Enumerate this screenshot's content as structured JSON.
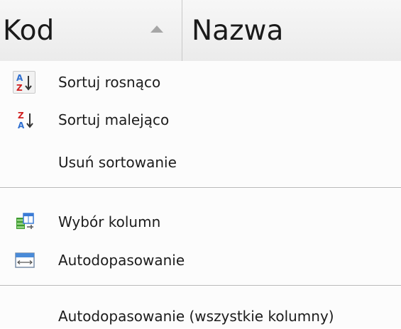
{
  "header": {
    "columns": [
      {
        "label": "Kod",
        "sorted": "ascending"
      },
      {
        "label": "Nazwa"
      }
    ]
  },
  "menu": {
    "items": [
      {
        "label": "Sortuj rosnąco",
        "icon": "sort-ascending-icon",
        "checked": true
      },
      {
        "label": "Sortuj malejąco",
        "icon": "sort-descending-icon"
      },
      {
        "label": "Usuń sortowanie"
      },
      {
        "label": "Wybór kolumn",
        "icon": "column-chooser-icon"
      },
      {
        "label": "Autodopasowanie",
        "icon": "best-fit-icon"
      },
      {
        "label": "Autodopasowanie (wszystkie kolumny)"
      }
    ]
  },
  "colors": {
    "icon_blue": "#2f6fd0",
    "icon_red": "#d02020",
    "icon_green": "#3c9a2e"
  }
}
